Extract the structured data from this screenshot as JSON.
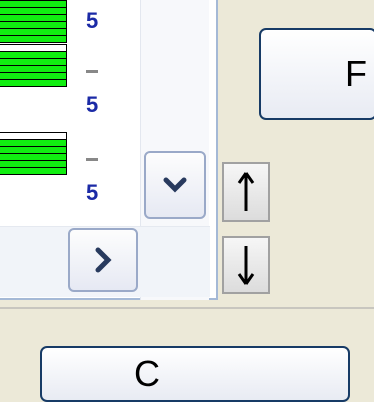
{
  "rows": [
    {
      "bars": [
        1,
        1,
        1,
        1,
        1,
        1
      ],
      "dash": false,
      "label": "5"
    },
    {
      "bars": [
        0,
        1,
        1,
        1,
        1,
        1
      ],
      "dash": true,
      "label": "5"
    },
    {
      "bars": [
        0,
        1,
        1,
        1,
        1,
        1
      ],
      "dash": true,
      "label": "5"
    }
  ],
  "colors": {
    "bar_fill": "#11ee11",
    "label": "#1b2aa6",
    "window_bg": "#ece9d8"
  },
  "buttons": {
    "top_right_label": "F",
    "bottom_label": "C"
  },
  "icons": {
    "scroll_down": "chevron-down-icon",
    "scroll_right": "chevron-right-icon",
    "move_up": "arrow-up-icon",
    "move_down": "arrow-down-icon"
  }
}
